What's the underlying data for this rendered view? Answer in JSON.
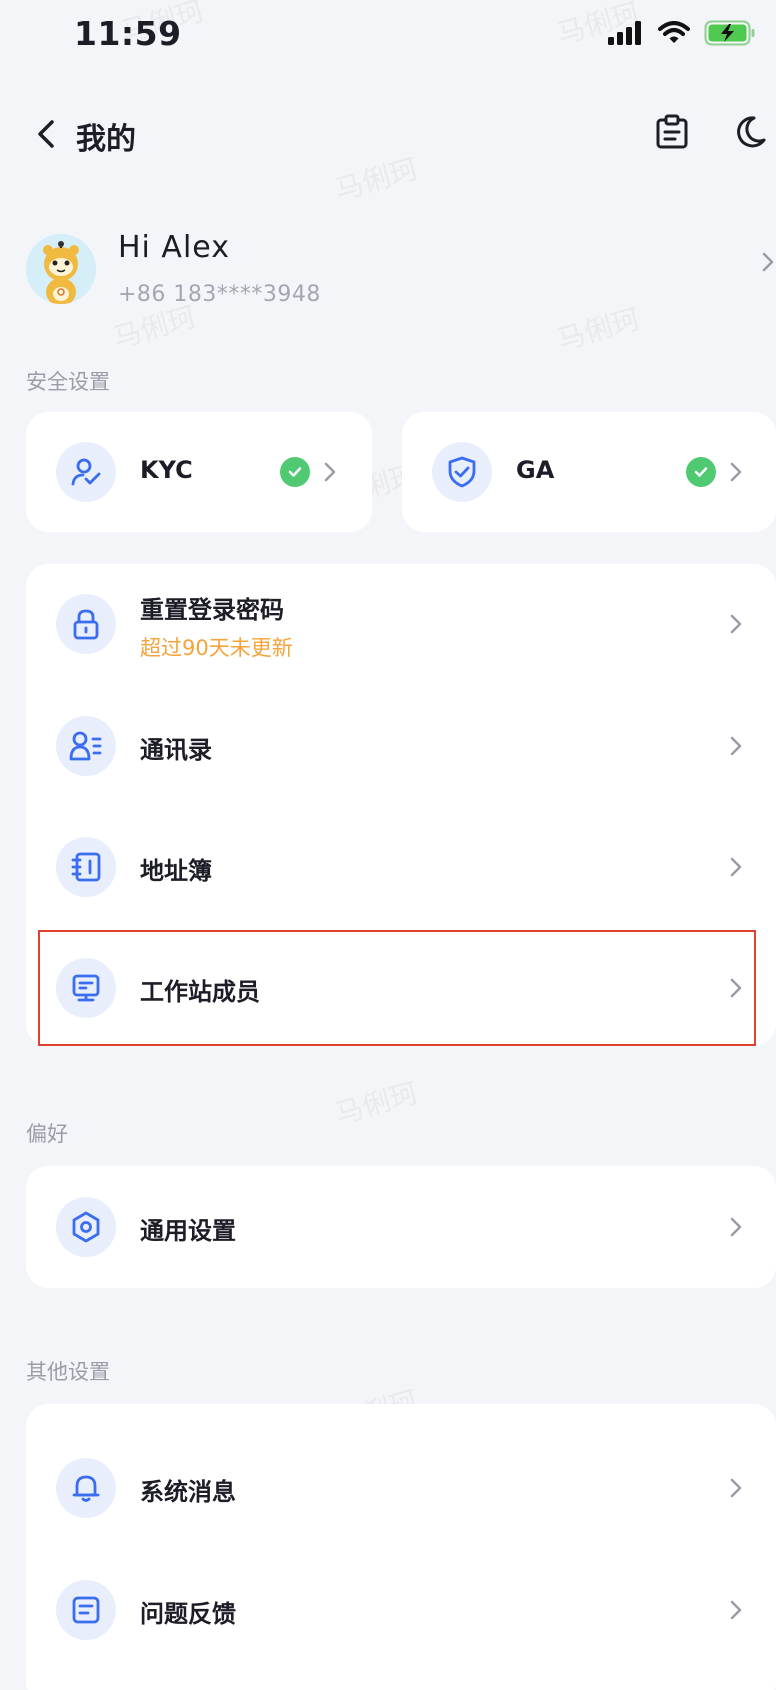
{
  "status_bar": {
    "time": "11:59"
  },
  "nav": {
    "title": "我的"
  },
  "profile": {
    "greeting": "Hi  Alex",
    "phone": "+86 183****3948"
  },
  "sections": {
    "security": "安全设置",
    "preferences": "偏好",
    "others": "其他设置"
  },
  "security_cards": [
    {
      "label": "KYC",
      "icon": "user-verify-icon",
      "verified": true
    },
    {
      "label": "GA",
      "icon": "shield-check-icon",
      "verified": true
    }
  ],
  "security_list": [
    {
      "title": "重置登录密码",
      "subtitle": "超过90天未更新",
      "icon": "lock-icon"
    },
    {
      "title": "通讯录",
      "icon": "contacts-icon"
    },
    {
      "title": "地址簿",
      "icon": "address-book-icon"
    },
    {
      "title": "工作站成员",
      "icon": "workstation-icon"
    }
  ],
  "preferences_list": [
    {
      "title": "通用设置",
      "icon": "settings-hex-icon"
    }
  ],
  "others_list": [
    {
      "title": "系统消息",
      "icon": "bell-icon"
    },
    {
      "title": "问题反馈",
      "icon": "feedback-icon"
    }
  ],
  "watermark_text": "马俐珂",
  "colors": {
    "accent": "#3b6df0",
    "warning": "#f5a33b",
    "success": "#4fca72",
    "highlight": "#e2412f"
  }
}
